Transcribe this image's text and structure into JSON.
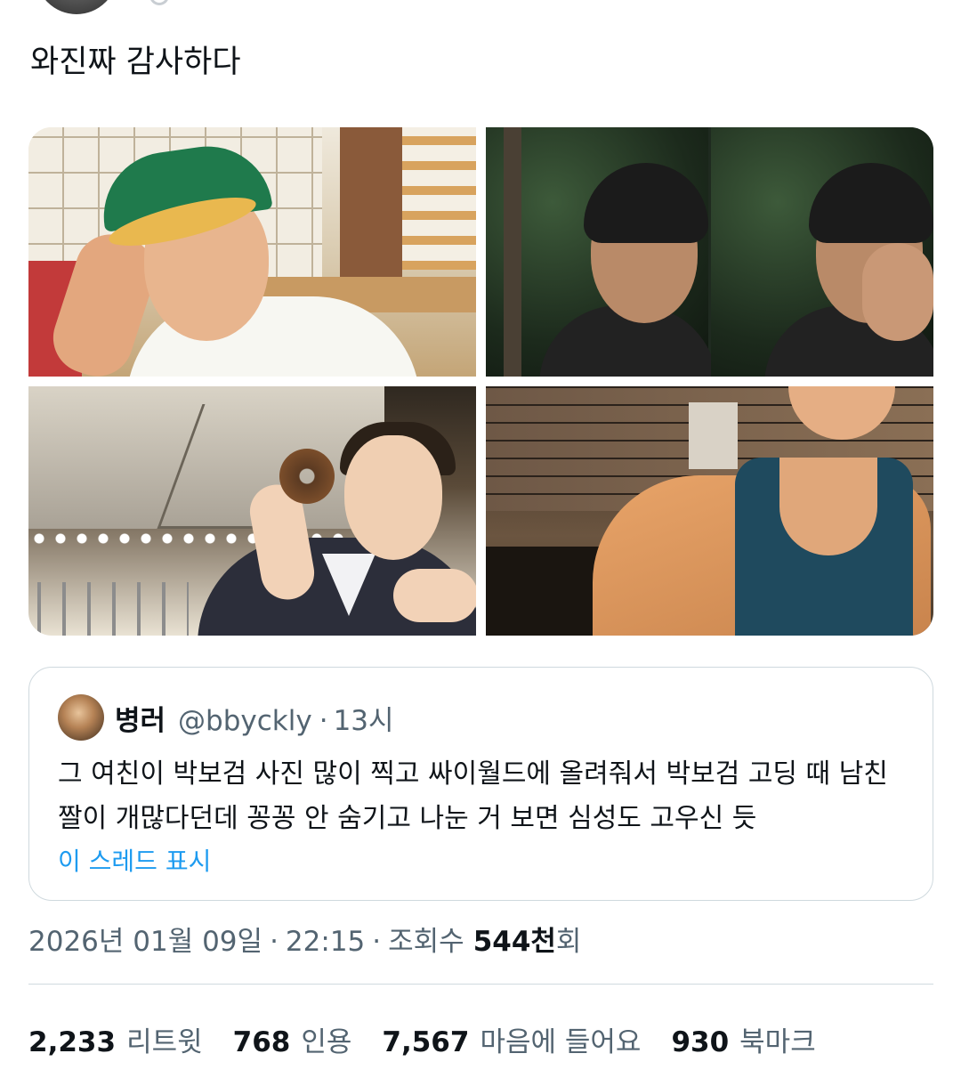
{
  "tweet": {
    "text": "와진짜 감사하다"
  },
  "media": {
    "photos": [
      {
        "description_icon": "photo-smiling-cap"
      },
      {
        "description_icon": "photo-night-selfie"
      },
      {
        "description_icon": "photo-donut-suit"
      },
      {
        "description_icon": "photo-tank-top"
      }
    ]
  },
  "quote": {
    "name": "병러",
    "handle": "@bbyckly",
    "separator": "·",
    "time": "13시",
    "body": "그 여친이 박보검 사진 많이 찍고 싸이월드에 올려줘서 박보검 고딩 때 남친짤이 개많다던데 꽁꽁 안 숨기고 나눈 거 보면 심성도 고우신 듯",
    "show_thread": "이 스레드 표시"
  },
  "meta": {
    "date": "2026년 01월 09일",
    "sep1": "·",
    "time": "22:15",
    "sep2": "·",
    "views_label": "조회수",
    "views_count": "544천",
    "views_suffix": "회"
  },
  "stats": {
    "retweets": {
      "count": "2,233",
      "label": "리트윗"
    },
    "quotes": {
      "count": "768",
      "label": "인용"
    },
    "likes": {
      "count": "7,567",
      "label": "마음에 들어요"
    },
    "bookmarks": {
      "count": "930",
      "label": "북마크"
    }
  },
  "colors": {
    "text_primary": "#0f1419",
    "text_secondary": "#536471",
    "link": "#1d9bf0",
    "border": "#cfd9de"
  }
}
